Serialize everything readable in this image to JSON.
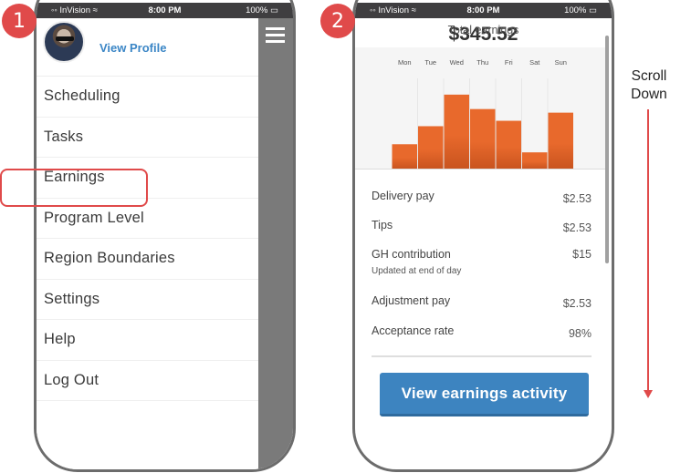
{
  "steps": [
    "1",
    "2"
  ],
  "status_bar": {
    "carrier": "◦◦ InVision ≈",
    "time": "8:00 PM",
    "battery": "100% ▭"
  },
  "menu": {
    "view_profile": "View Profile",
    "items": [
      "Scheduling",
      "Tasks",
      "Earnings",
      "Program Level",
      "Region Boundaries",
      "Settings",
      "Help",
      "Log Out"
    ],
    "highlighted": "Earnings",
    "icons": {
      "menu": "hamburger-icon",
      "avatar": "avatar"
    }
  },
  "earnings": {
    "total": "$345.52",
    "total_label": "Total earnings",
    "rows": [
      {
        "label": "Delivery pay",
        "value": "$2.53"
      },
      {
        "label": "Tips",
        "value": "$2.53"
      },
      {
        "label": "GH contribution",
        "value": "$15",
        "note": "Updated at end of day"
      },
      {
        "label": "Adjustment pay",
        "value": "$2.53"
      },
      {
        "label": "Acceptance rate",
        "value": "98%"
      }
    ],
    "cta": "View earnings activity"
  },
  "annotation": {
    "scroll_text_1": "Scroll",
    "scroll_text_2": "Down",
    "accent": "#e04a4a"
  },
  "chart_data": {
    "type": "bar",
    "title": "",
    "categories": [
      "Mon",
      "Tue",
      "Wed",
      "Thu",
      "Fri",
      "Sat",
      "Sun"
    ],
    "values": [
      27,
      47,
      82,
      66,
      53,
      18,
      62
    ],
    "ylim": [
      0,
      100
    ],
    "xlabel": "",
    "ylabel": "",
    "grid": true,
    "color": "#e8692c"
  }
}
